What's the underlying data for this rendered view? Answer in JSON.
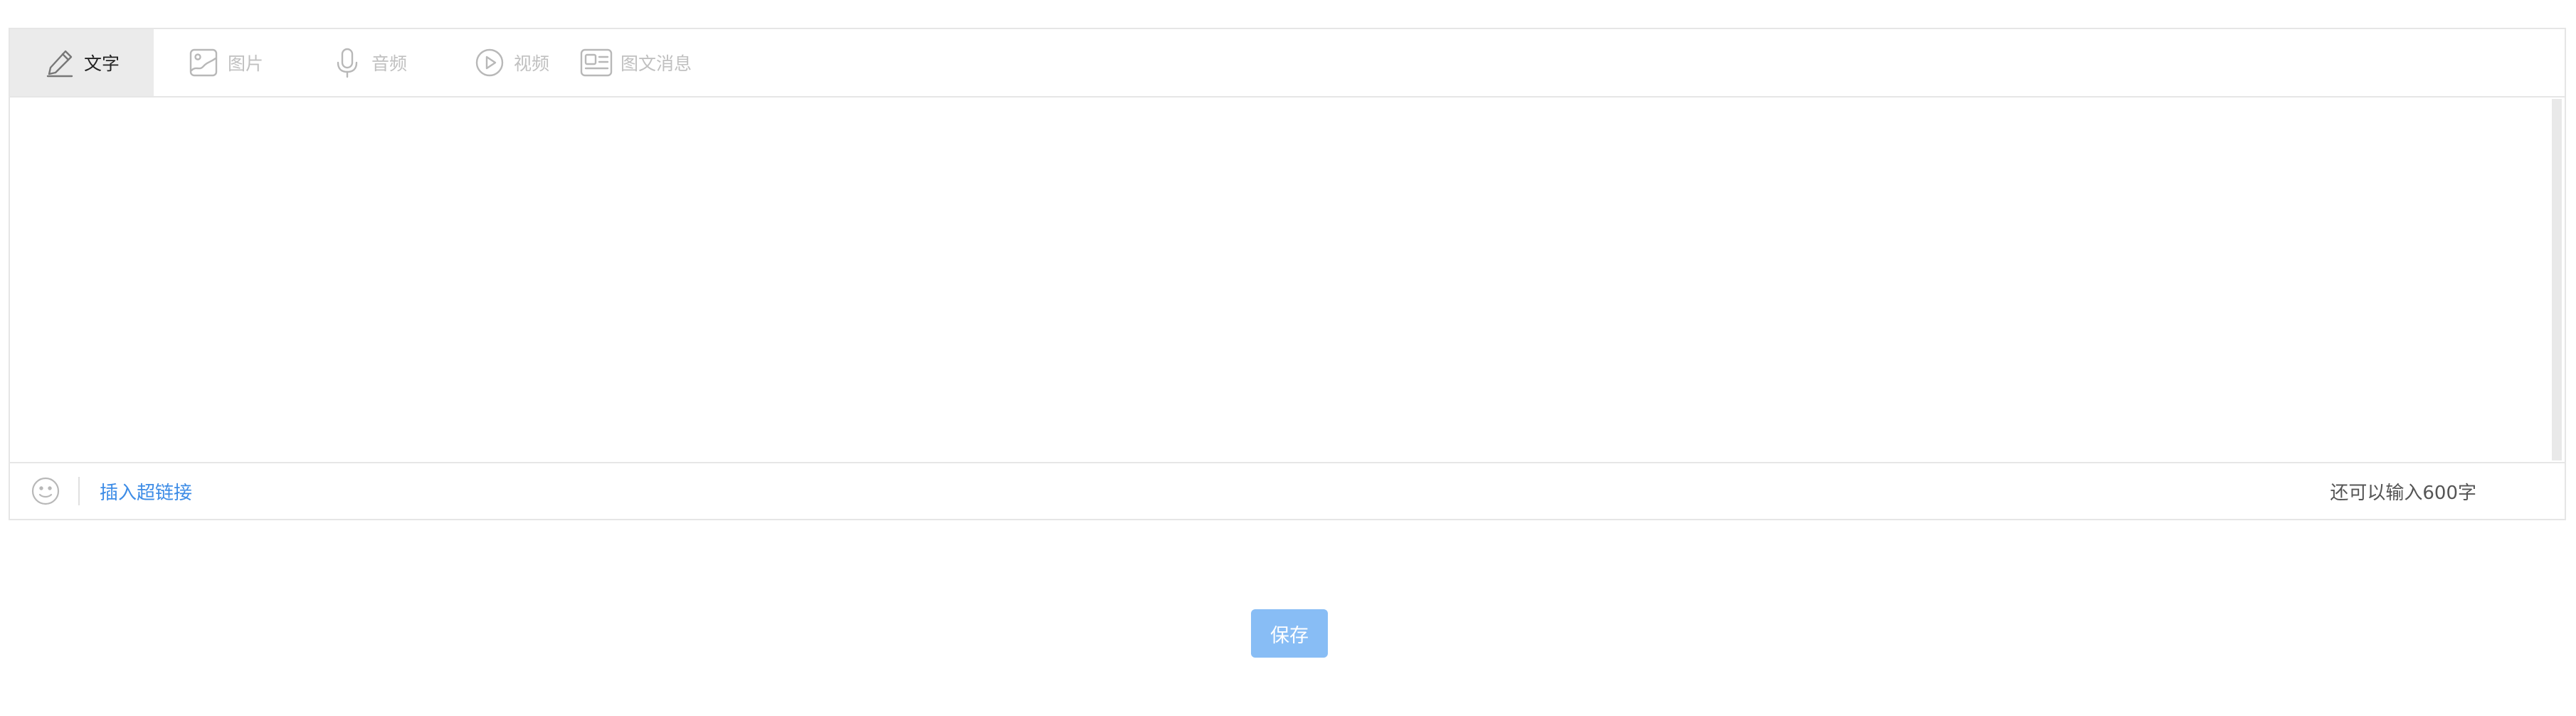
{
  "tabs": [
    {
      "label": "文字",
      "icon": "pencil-icon",
      "active": true
    },
    {
      "label": "图片",
      "icon": "image-icon",
      "active": false
    },
    {
      "label": "音频",
      "icon": "microphone-icon",
      "active": false
    },
    {
      "label": "视频",
      "icon": "play-circle-icon",
      "active": false
    },
    {
      "label": "图文消息",
      "icon": "news-card-icon",
      "active": false
    }
  ],
  "editor": {
    "value": "",
    "placeholder": ""
  },
  "footer": {
    "emoji_icon": "smiley-icon",
    "insert_link_label": "插入超链接",
    "counter_text": "还可以输入600字"
  },
  "save_label": "保存",
  "colors": {
    "accent": "#3d8ce6",
    "save_button": "#88bdf5",
    "active_tab_bg": "#ebebeb",
    "inactive_text": "#c0c0c0",
    "border": "#e6e6e6"
  }
}
